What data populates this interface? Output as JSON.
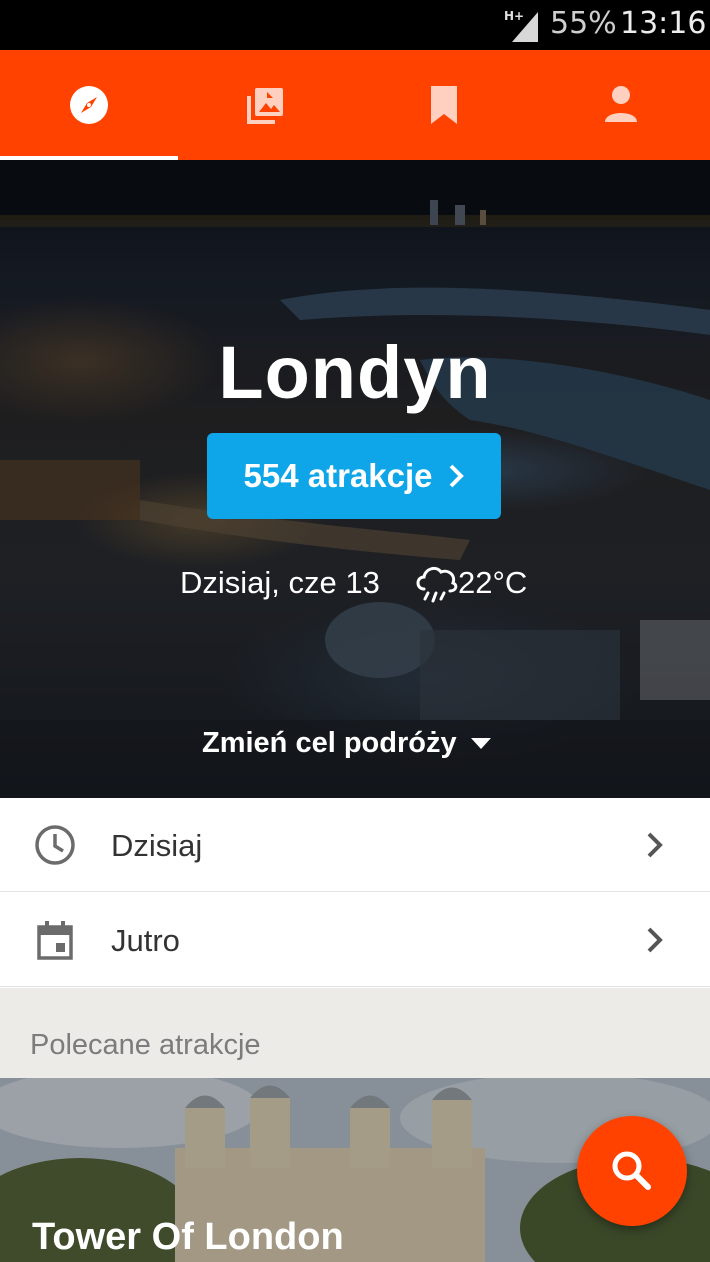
{
  "status_bar": {
    "network": "H+",
    "battery": "55%",
    "time": "13:16",
    "icons": [
      "signal-icon"
    ]
  },
  "tabs": [
    {
      "name": "explore",
      "icon": "compass-icon",
      "active": true
    },
    {
      "name": "collections",
      "icon": "photo-library-icon",
      "active": false
    },
    {
      "name": "bookmarks",
      "icon": "bookmark-icon",
      "active": false
    },
    {
      "name": "profile",
      "icon": "person-icon",
      "active": false
    }
  ],
  "hero": {
    "city": "Londyn",
    "attractions_label": "554 atrakcje",
    "date": "Dzisiaj, cze 13",
    "weather_icon": "rain-cloud-icon",
    "temperature": "22°C",
    "change_destination": "Zmień cel podróży"
  },
  "list": [
    {
      "label": "Dzisiaj",
      "icon": "clock-icon"
    },
    {
      "label": "Jutro",
      "icon": "calendar-icon"
    }
  ],
  "recommended": {
    "header": "Polecane atrakcje",
    "items": [
      {
        "title": "Tower Of London"
      }
    ]
  },
  "fab": {
    "icon": "search-icon"
  },
  "colors": {
    "brand": "#ff4200",
    "accent": "#0ea5e9",
    "section_bg": "#ecebe8"
  }
}
